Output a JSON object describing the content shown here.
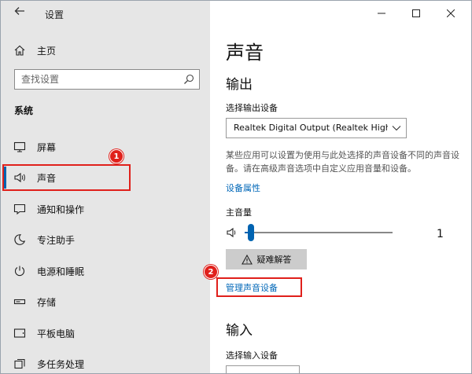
{
  "app": {
    "title": "设置"
  },
  "sidebar": {
    "home_label": "主页",
    "search_placeholder": "查找设置",
    "section_title": "系统",
    "items": [
      {
        "label": "屏幕",
        "icon": "monitor-icon"
      },
      {
        "label": "声音",
        "icon": "speaker-icon",
        "selected": true
      },
      {
        "label": "通知和操作",
        "icon": "notification-icon"
      },
      {
        "label": "专注助手",
        "icon": "moon-icon"
      },
      {
        "label": "电源和睡眠",
        "icon": "power-icon"
      },
      {
        "label": "存储",
        "icon": "storage-icon"
      },
      {
        "label": "平板电脑",
        "icon": "tablet-icon"
      },
      {
        "label": "多任务处理",
        "icon": "multitask-icon"
      }
    ]
  },
  "annotations": {
    "badge_1": "1",
    "badge_2": "2"
  },
  "main": {
    "title": "声音",
    "output": {
      "heading": "输出",
      "device_label": "选择输出设备",
      "device_value": "Realtek Digital Output (Realtek High...",
      "description": "某些应用可以设置为使用与此处选择的声音设备不同的声音设备。请在高级声音选项中自定义应用音量和设备。",
      "device_properties_link": "设备属性",
      "master_volume_label": "主音量",
      "volume_value": "1",
      "volume_level": 1,
      "troubleshoot_label": "疑难解答",
      "manage_devices_link": "管理声音设备"
    },
    "input": {
      "heading": "输入",
      "device_label": "选择输入设备"
    }
  },
  "colors": {
    "accent": "#0063b1",
    "link": "#0067b8",
    "annotation": "#e0201b",
    "sidebar_bg": "#e6e6e6"
  }
}
